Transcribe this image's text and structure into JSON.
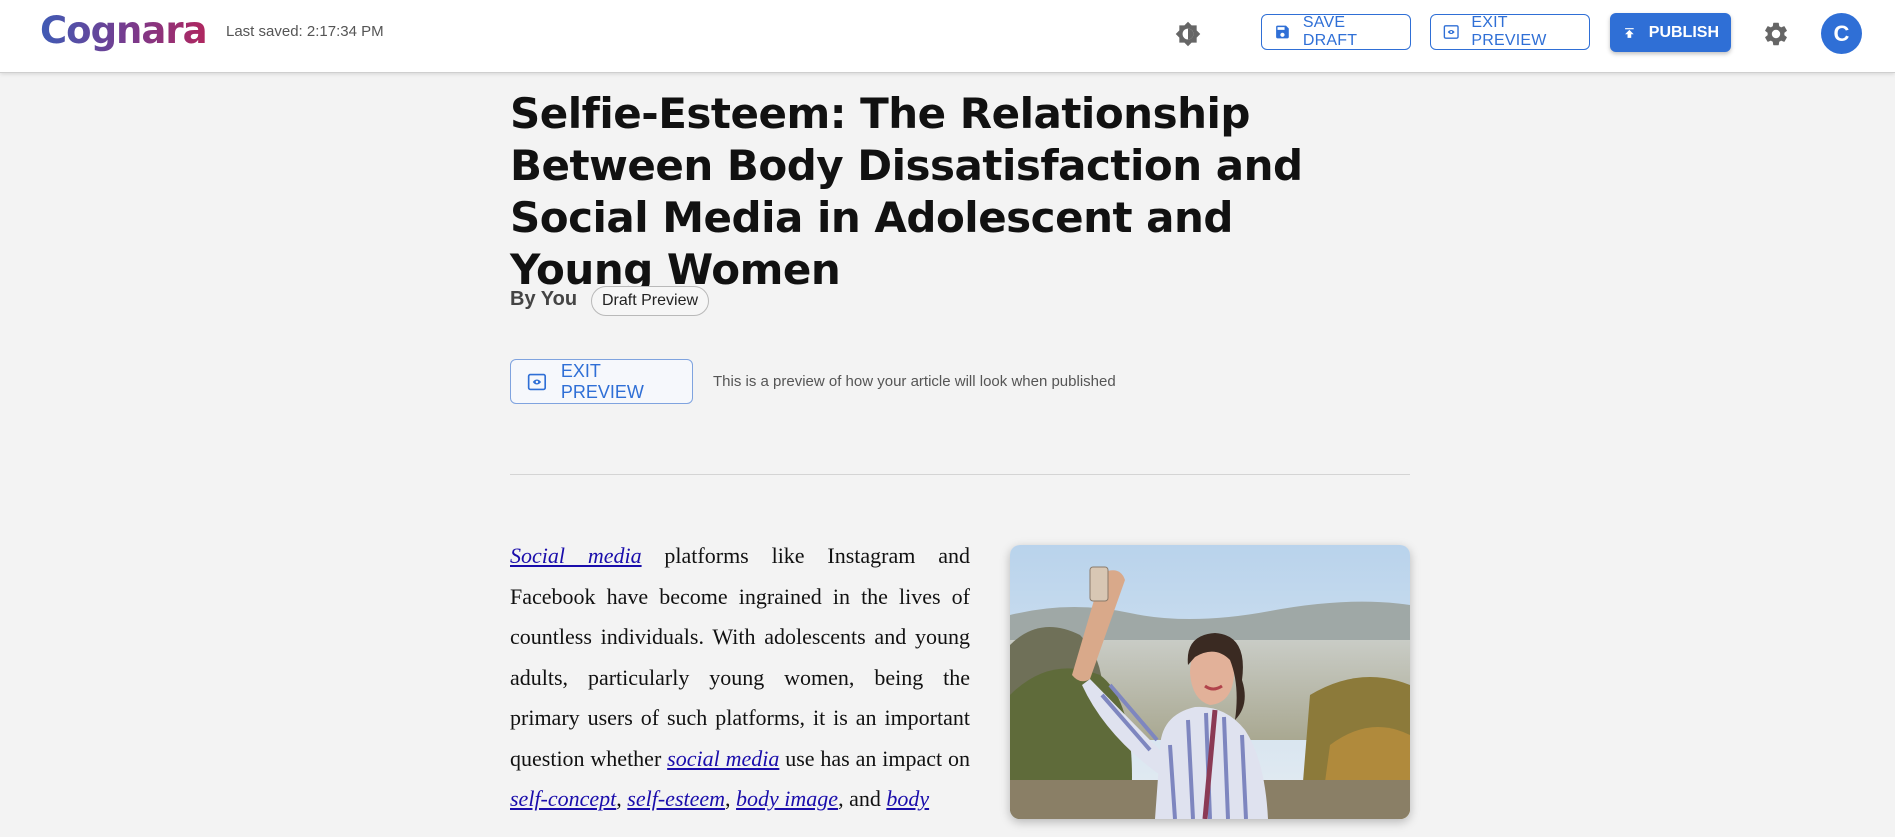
{
  "app": {
    "logo": "Cognara",
    "last_saved": "Last saved: 2:17:34 PM"
  },
  "toolbar": {
    "save_draft_label": "SAVE DRAFT",
    "exit_preview_label": "EXIT PREVIEW",
    "publish_label": "PUBLISH",
    "avatar_initial": "C",
    "icons": {
      "theme": "theme-toggle-icon",
      "save": "save-icon",
      "preview": "preview-eye-icon",
      "publish": "publish-upload-icon",
      "settings": "gear-icon"
    }
  },
  "article": {
    "title": "Selfie-Esteem: The Relationship Between Body Dissatisfaction and Social Media in Adolescent and Young Women",
    "byline": "By You",
    "status_chip": "Draft Preview",
    "exit_preview_label": "EXIT PREVIEW",
    "preview_note": "This is a preview of how your article will look when published",
    "body": {
      "link_social_media_1": "Social media",
      "text_1": " platforms like Instagram and Facebook have become ingrained in the lives of countless individuals. With adolescents and young adults, particularly young women, being the primary users of such platforms, it is an important question whether ",
      "link_social_media_2": "social media",
      "text_2": " use has an impact on ",
      "link_self_concept": "self-concept",
      "text_3": ", ",
      "link_self_esteem": "self-esteem",
      "text_4": ", ",
      "link_body_image": "body image",
      "text_5": ", and ",
      "link_body_dissatisfaction": "body"
    },
    "image": {
      "subject": "woman-taking-selfie-photo"
    }
  },
  "colors": {
    "accent": "#2f6fd6",
    "link": "#1a0dab",
    "background": "#f3f3f3"
  }
}
